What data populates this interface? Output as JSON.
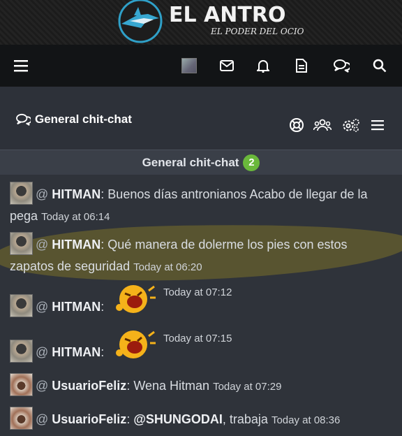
{
  "brand": {
    "name": "EL ANTRO",
    "tagline": "EL PODER DEL OCIO"
  },
  "navbar": {
    "icons": [
      "menu-icon",
      "user-avatar",
      "envelope-icon",
      "bell-icon",
      "document-icon",
      "chat-icon",
      "search-icon"
    ]
  },
  "section": {
    "title": "General chit-chat",
    "icons": [
      "lifebuoy-icon",
      "users-icon",
      "settings-icon",
      "menu-icon"
    ]
  },
  "chat": {
    "title": "General chit-chat",
    "badge_count": "2",
    "messages": [
      {
        "user": "HITMAN",
        "text": "Buenos días antronianos Acabo de llegar de la pega",
        "time": "Today at 06:14"
      },
      {
        "user": "HITMAN",
        "text": "Qué manera de dolerme los pies con estos zapatos de seguridad",
        "time": "Today at 06:20"
      },
      {
        "user": "HITMAN",
        "text": "",
        "time": "Today at 07:12",
        "emoji": "laughing-emoji"
      },
      {
        "user": "HITMAN",
        "text": "",
        "time": "Today at 07:15",
        "emoji": "laughing-emoji"
      },
      {
        "user": "UsuarioFeliz",
        "text": "Wena Hitman",
        "time": "Today at 07:29"
      },
      {
        "user": "UsuarioFeliz",
        "mention": "@SHUNGODAI",
        "text": ", trabaja",
        "time": "Today at 08:36"
      }
    ]
  },
  "colors": {
    "badge": "#6ab83b",
    "highlight": "#7a7028",
    "navbar": "#121416"
  }
}
